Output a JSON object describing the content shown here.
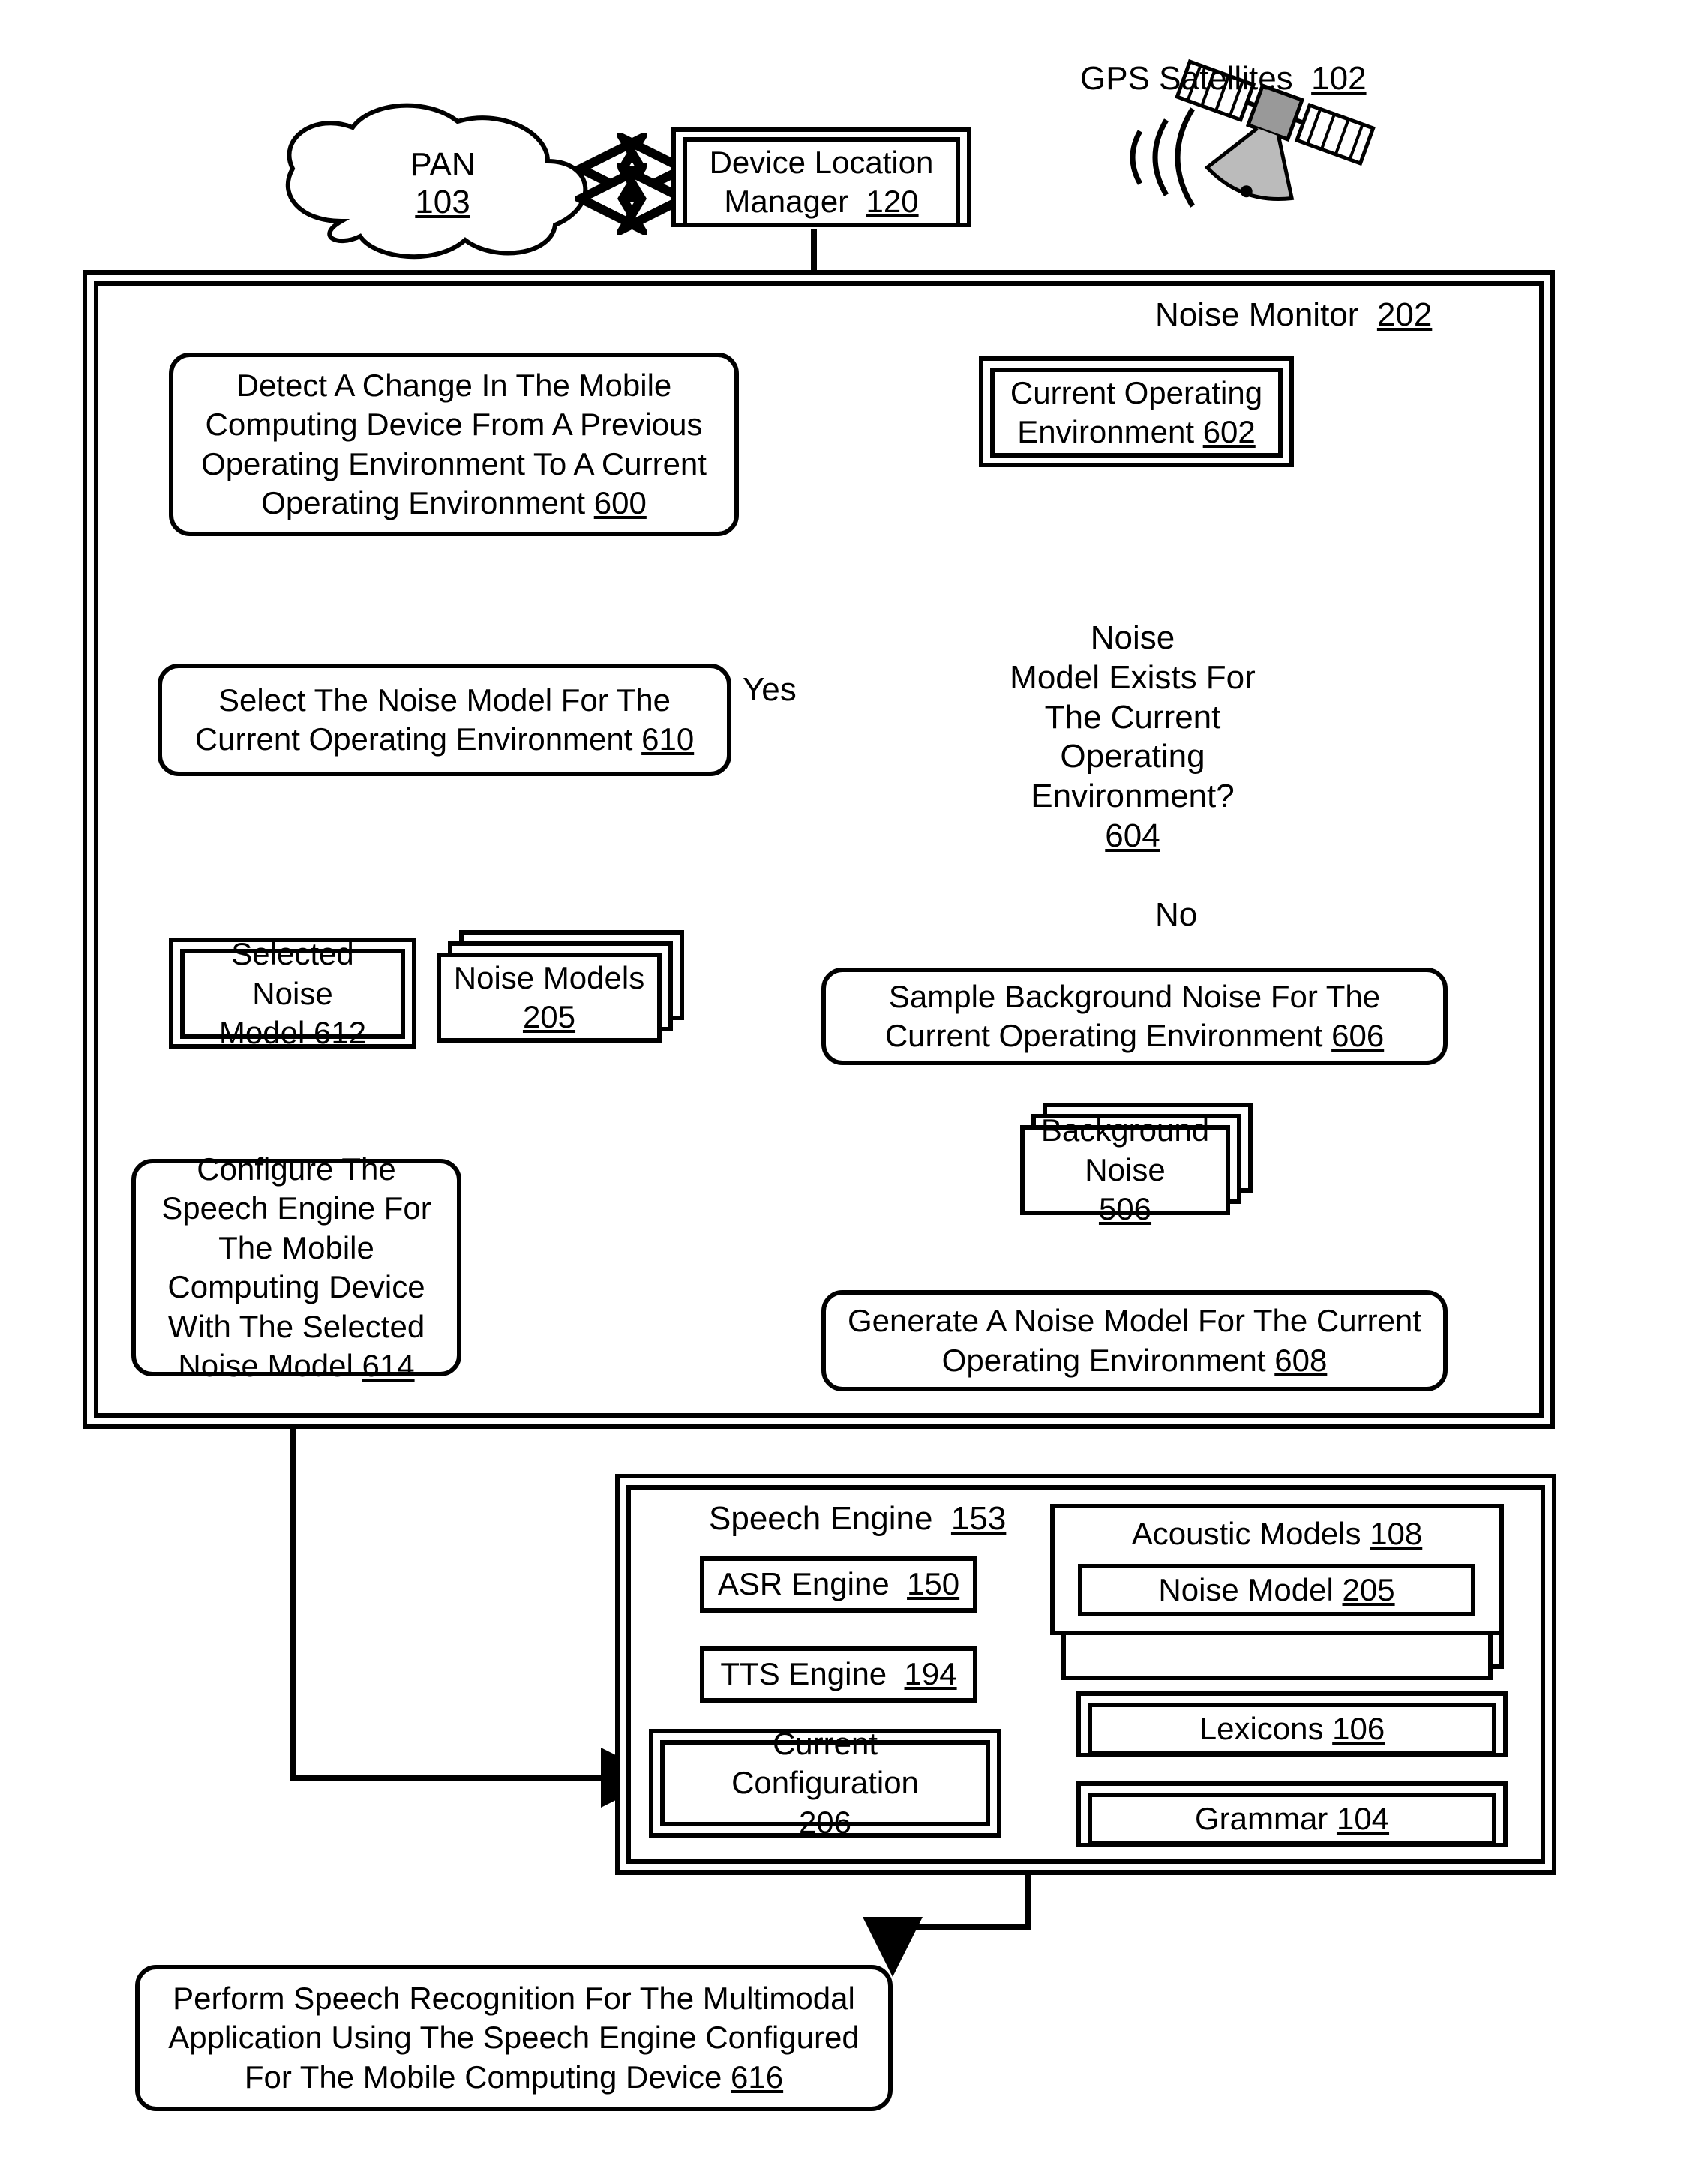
{
  "top": {
    "gps_label": "GPS Satellites",
    "gps_num": "102",
    "pan_name": "PAN",
    "pan_num": "103",
    "dlm_name": "Device Location",
    "dlm_name2": "Manager",
    "dlm_num": "120"
  },
  "monitor": {
    "title": "Noise Monitor",
    "title_num": "202",
    "detect": "Detect A Change In The Mobile Computing Device From A Previous Operating Environment To A Current Operating Environment",
    "detect_num": "600",
    "cur_env": "Current Operating Environment",
    "cur_env_num": "602",
    "decision_1": "Noise",
    "decision_2": "Model Exists For",
    "decision_3": "The Current Operating",
    "decision_4": "Environment?",
    "decision_num": "604",
    "yes": "Yes",
    "no": "No",
    "select_model": "Select The Noise Model For The Current Operating Environment",
    "select_model_num": "610",
    "selected_noise": "Selected Noise Model",
    "selected_noise_num": "612",
    "noise_models": "Noise Models",
    "noise_models_num": "205",
    "configure": "Configure The Speech Engine For The Mobile Computing Device With The Selected Noise Model",
    "configure_num": "614",
    "sample": "Sample Background Noise For The Current Operating Environment",
    "sample_num": "606",
    "bg_noise": "Background Noise",
    "bg_noise_num": "506",
    "generate": "Generate A Noise Model For The Current Operating Environment",
    "generate_num": "608"
  },
  "engine": {
    "title": "Speech Engine",
    "title_num": "153",
    "asr": "ASR Engine",
    "asr_num": "150",
    "tts": "TTS Engine",
    "tts_num": "194",
    "cur_cfg": "Current Configuration",
    "cur_cfg_num": "206",
    "acoustic": "Acoustic Models",
    "acoustic_num": "108",
    "noise_model": "Noise Model",
    "noise_model_num": "205",
    "lexicons": "Lexicons",
    "lexicons_num": "106",
    "grammar": "Grammar",
    "grammar_num": "104"
  },
  "final": {
    "text": "Perform Speech Recognition For The Multimodal Application Using The Speech Engine Configured For The Mobile Computing Device",
    "num": "616"
  }
}
